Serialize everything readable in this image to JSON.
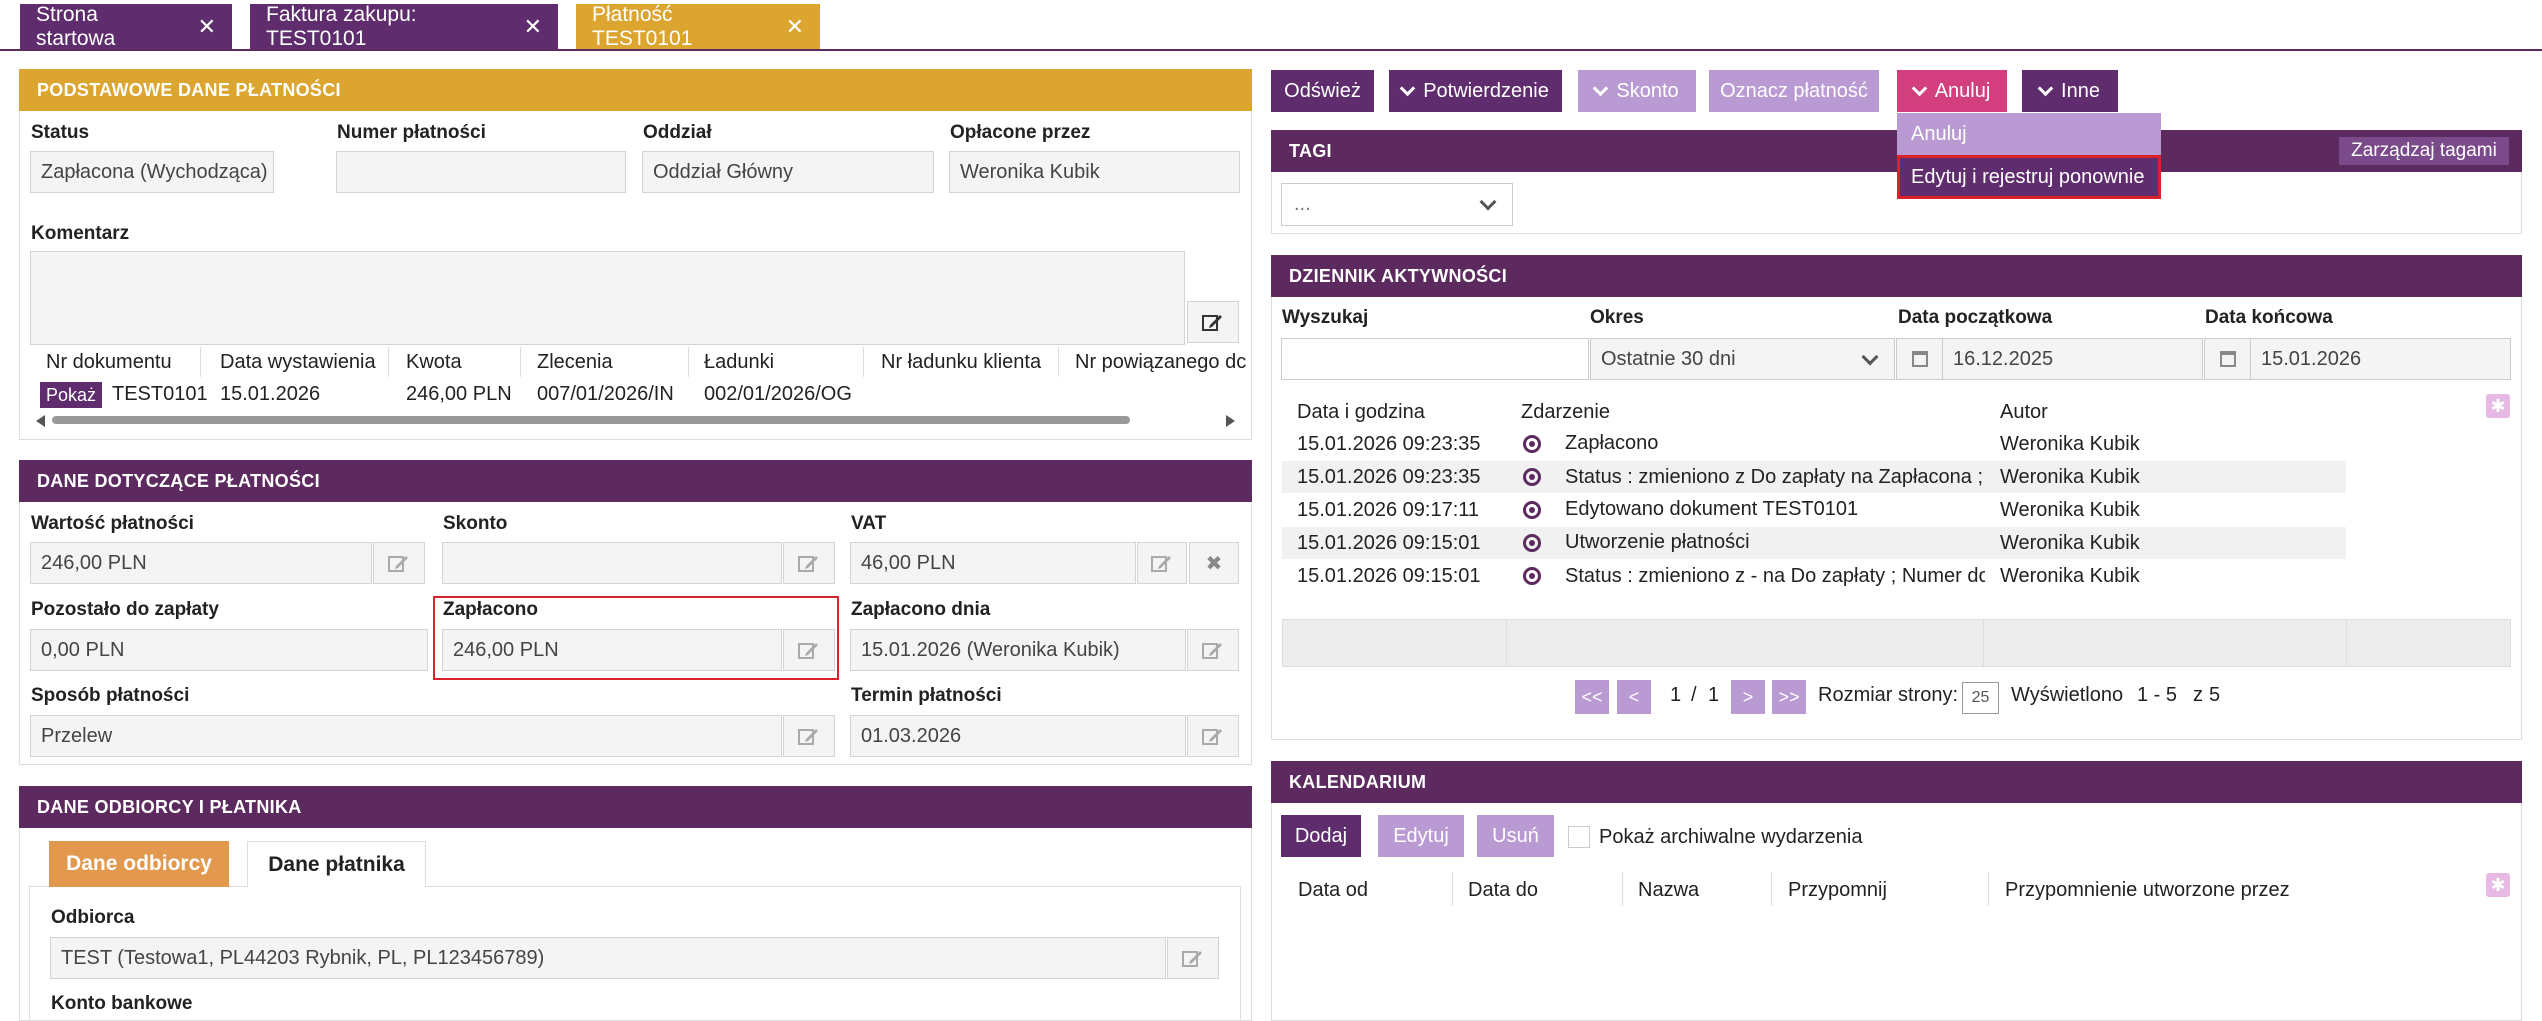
{
  "tabs": [
    {
      "label": "Strona startowa"
    },
    {
      "label": "Faktura zakupu: TEST0101"
    },
    {
      "label": "Płatność TEST0101"
    }
  ],
  "basic": {
    "header": "PODSTAWOWE DANE PŁATNOŚCI",
    "status_label": "Status",
    "status_value": "Zapłacona (Wychodząca)",
    "payment_no_label": "Numer płatności",
    "payment_no_value": "",
    "branch_label": "Oddział",
    "branch_value": "Oddział Główny",
    "paid_by_label": "Opłacone przez",
    "paid_by_value": "Weronika Kubik",
    "comment_label": "Komentarz",
    "doc_table": {
      "columns": [
        "Nr dokumentu",
        "Data wystawienia",
        "Kwota",
        "Zlecenia",
        "Ładunki",
        "Nr ładunku klienta",
        "Nr powiązanego dc"
      ],
      "show_label": "Pokaż",
      "row": [
        "TEST0101",
        "15.01.2026",
        "246,00 PLN",
        "007/01/2026/IN",
        "002/01/2026/OG"
      ]
    }
  },
  "payment": {
    "header": "DANE DOTYCZĄCE PŁATNOŚCI",
    "value_label": "Wartość płatności",
    "value": "246,00 PLN",
    "skonto_label": "Skonto",
    "skonto": "",
    "vat_label": "VAT",
    "vat": "46,00 PLN",
    "remaining_label": "Pozostało do zapłaty",
    "remaining": "0,00 PLN",
    "paid_label": "Zapłacono",
    "paid": "246,00 PLN",
    "paid_date_label": "Zapłacono dnia",
    "paid_date": "15.01.2026 (Weronika Kubik)",
    "method_label": "Sposób płatności",
    "method": "Przelew",
    "due_label": "Termin płatności",
    "due": "01.03.2026"
  },
  "recipient": {
    "header": "DANE ODBIORCY I PŁATNIKA",
    "tab_recipient": "Dane odbiorcy",
    "tab_payer": "Dane płatnika",
    "recipient_label": "Odbiorca",
    "recipient_value": "TEST (Testowa1, PL44203 Rybnik, PL, PL123456789)",
    "bank_label": "Konto bankowe"
  },
  "toolbar": {
    "refresh": "Odśwież",
    "confirm": "Potwierdzenie",
    "skonto": "Skonto",
    "mark": "Oznacz płatność",
    "cancel": "Anuluj",
    "other": "Inne"
  },
  "dropdown": {
    "items": [
      "Anuluj",
      "Edytuj i rejestruj ponownie"
    ]
  },
  "tags": {
    "header": "TAGI",
    "manage": "Zarządzaj tagami",
    "select_value": "..."
  },
  "activity": {
    "header": "DZIENNIK AKTYWNOŚCI",
    "search_label": "Wyszukaj",
    "period_label": "Okres",
    "period_value": "Ostatnie 30 dni",
    "start_label": "Data początkowa",
    "start_value": "16.12.2025",
    "end_label": "Data końcowa",
    "end_value": "15.01.2026",
    "columns": [
      "Data i godzina",
      "Zdarzenie",
      "Autor"
    ],
    "rows": [
      {
        "date": "15.01.2026 09:23:35",
        "event": "Zapłacono",
        "author": "Weronika Kubik"
      },
      {
        "date": "15.01.2026 09:23:35",
        "event": "Status : zmieniono z Do zapłaty na Zapłacona ; Z",
        "author": "Weronika Kubik"
      },
      {
        "date": "15.01.2026 09:17:11",
        "event": "Edytowano dokument TEST0101",
        "author": "Weronika Kubik"
      },
      {
        "date": "15.01.2026 09:15:01",
        "event": "Utworzenie płatności",
        "author": "Weronika Kubik"
      },
      {
        "date": "15.01.2026 09:15:01",
        "event": "Status : zmieniono z - na Do zapłaty ; Numer dok",
        "author": "Weronika Kubik"
      }
    ],
    "pager": {
      "first": "<<",
      "prev": "<",
      "page": "1",
      "sep": "/",
      "total": "1",
      "next": ">",
      "last": ">>",
      "size_label": "Rozmiar strony:",
      "size_value": "25",
      "shown_label": "Wyświetlono",
      "shown_range": "1 - 5",
      "of": "z",
      "count": "5"
    }
  },
  "calendar": {
    "header": "KALENDARIUM",
    "add": "Dodaj",
    "edit": "Edytuj",
    "delete": "Usuń",
    "archive_label": "Pokaż archiwalne wydarzenia",
    "columns": [
      "Data od",
      "Data do",
      "Nazwa",
      "Przypomnij",
      "Przypomnienie utworzone przez"
    ]
  },
  "colors": {
    "purple_dark": "#5c2a5e",
    "purple_btn": "#5f2d6e",
    "purple_light": "#b99ad3",
    "gold": "#dba52f",
    "pink": "#d33f7e",
    "red_highlight": "#d9222a"
  }
}
